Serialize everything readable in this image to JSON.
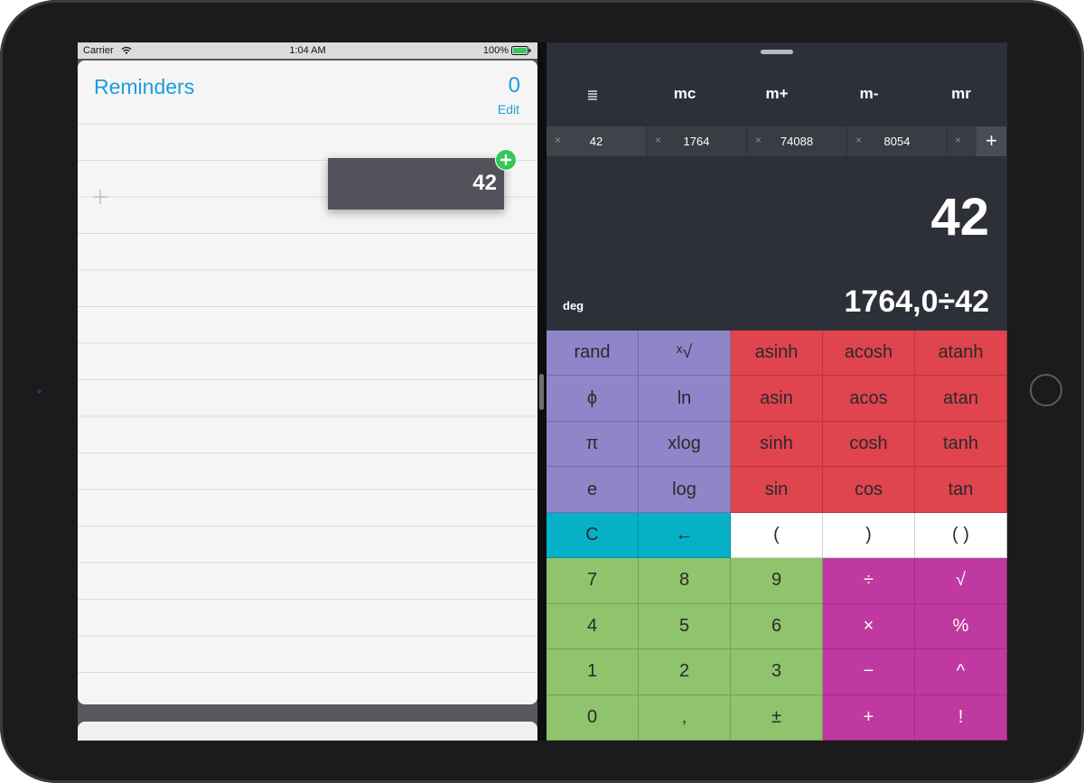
{
  "status": {
    "carrier": "Carrier",
    "time": "1:04 AM",
    "battery": "100%"
  },
  "reminders": {
    "title": "Reminders",
    "count": "0",
    "edit": "Edit",
    "drag_value": "42"
  },
  "calc": {
    "memory": [
      "mc",
      "m+",
      "m-",
      "mr"
    ],
    "history": [
      "42",
      "1764",
      "74088",
      "8054"
    ],
    "add_label": "+",
    "display": "42",
    "mode": "deg",
    "expression": "1764,0÷42",
    "keys": [
      "rand",
      "ˣ√",
      "asinh",
      "acosh",
      "atanh",
      "ϕ",
      "ln",
      "asin",
      "acos",
      "atan",
      "π",
      "xlog",
      "sinh",
      "cosh",
      "tanh",
      "e",
      "log",
      "sin",
      "cos",
      "tan",
      "C",
      "←",
      "(",
      ")",
      "( )",
      "7",
      "8",
      "9",
      "÷",
      "√",
      "4",
      "5",
      "6",
      "×",
      "%",
      "1",
      "2",
      "3",
      "−",
      "^",
      "0",
      ",",
      "±",
      "+",
      "!"
    ]
  },
  "colors": {
    "accent": "#1a9de3",
    "purple": "#8f86c9",
    "red": "#e0444e",
    "teal": "#06b1c8",
    "green": "#90c46c",
    "magenta": "#bf39a0",
    "calc_bg": "#2e3039"
  }
}
